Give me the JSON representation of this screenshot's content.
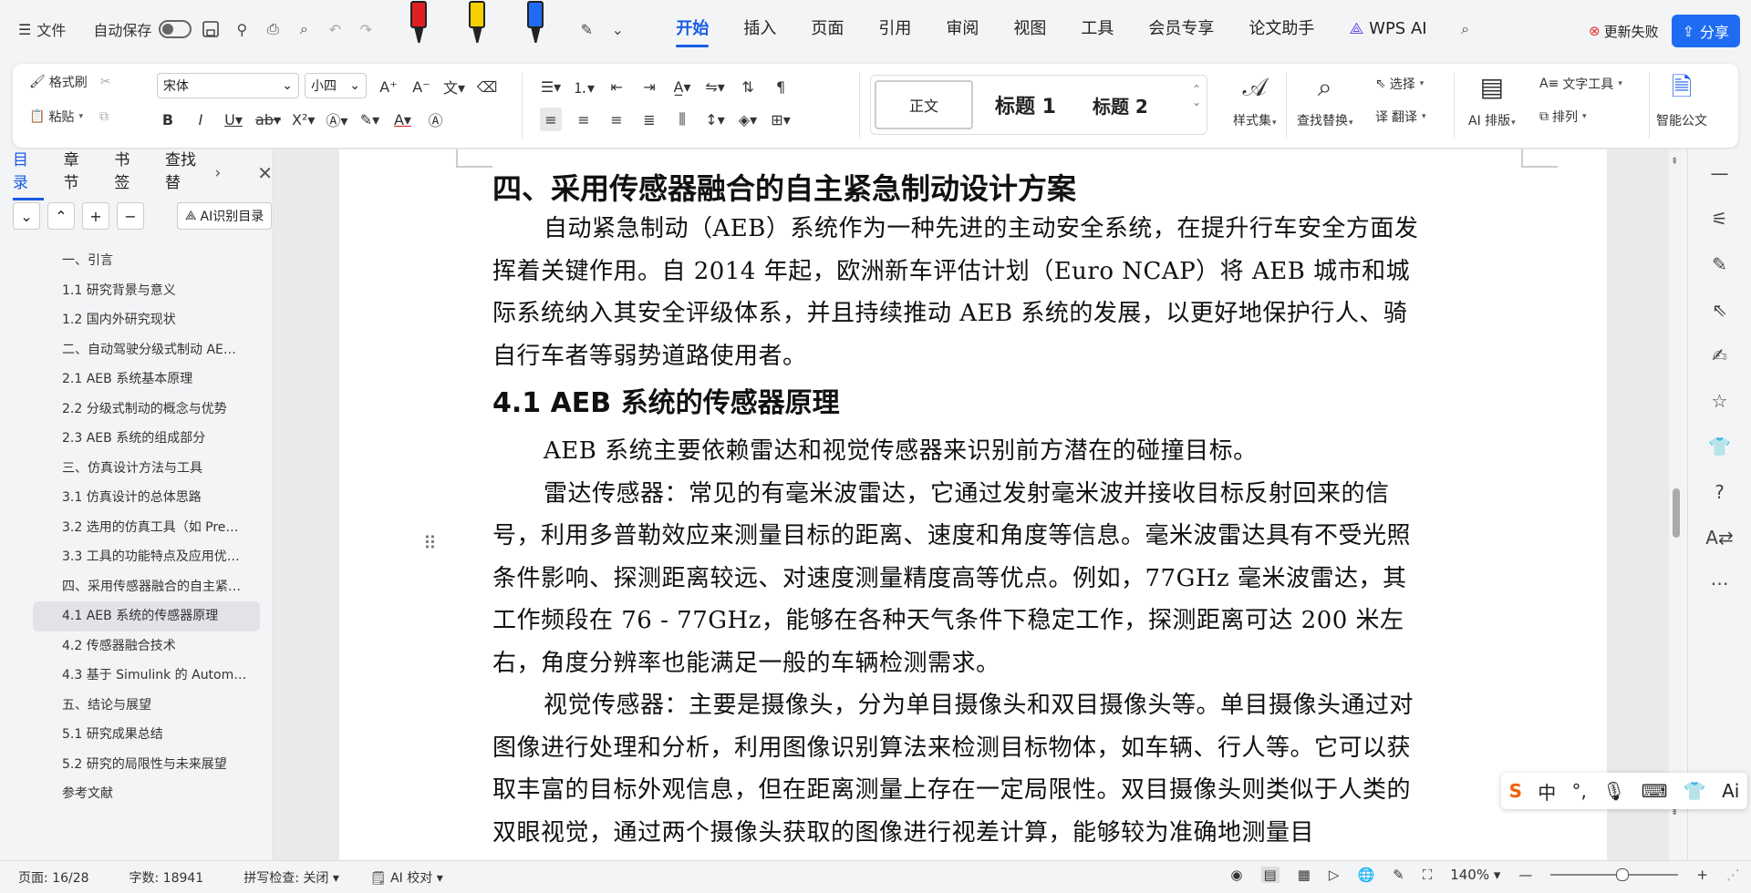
{
  "topbar": {
    "menu_label": "文件",
    "autosave_label": "自动保存",
    "tabs": [
      "开始",
      "插入",
      "页面",
      "引用",
      "审阅",
      "视图",
      "工具",
      "会员专享",
      "论文助手",
      "WPS AI"
    ],
    "active_tab": "开始",
    "update_label": "更新失败",
    "share_label": "分享"
  },
  "ribbon": {
    "format_painter": "格式刷",
    "paste": "粘贴",
    "font_name": "宋体",
    "font_size": "小四",
    "styles": {
      "normal": "正文",
      "h1": "标题 1",
      "h2": "标题 2"
    },
    "style_set": "样式集",
    "find_replace": "查找替换",
    "select": "选择",
    "translate": "翻译",
    "ai_layout": "AI 排版",
    "text_tools": "文字工具",
    "arrange": "排列",
    "smart_doc": "智能公文"
  },
  "leftpanel": {
    "tabs": [
      "目录",
      "章节",
      "书签",
      "查找替"
    ],
    "active_tab": "目录",
    "ai_toc_label": "AI识别目录",
    "toc": [
      "一、引言",
      "1.1 研究背景与意义",
      "1.2 国内外研究现状",
      "二、自动驾驶分级式制动 AE…",
      "2.1 AEB 系统基本原理",
      "2.2 分级式制动的概念与优势",
      "2.3 AEB 系统的组成部分",
      "三、仿真设计方法与工具",
      "3.1 仿真设计的总体思路",
      "3.2 选用的仿真工具（如 Pre…",
      "3.3 工具的功能特点及应用优…",
      "四、采用传感器融合的自主紧…",
      "4.1 AEB 系统的传感器原理",
      "4.2 传感器融合技术",
      "4.3 基于 Simulink 的 Autom…",
      "五、结论与展望",
      "5.1 研究成果总结",
      "5.2 研究的局限性与未来展望",
      "参考文献"
    ],
    "active_index": 12
  },
  "document": {
    "heading": "四、采用传感器融合的自主紧急制动设计方案",
    "para1": "自动紧急制动（AEB）系统作为一种先进的主动安全系统，在提升行车安全方面发挥着关键作用。自 2014 年起，欧洲新车评估计划（Euro NCAP）将 AEB 城市和城际系统纳入其安全评级体系，并且持续推动 AEB 系统的发展，以更好地保护行人、骑自行车者等弱势道路使用者。",
    "subheading": "4.1 AEB 系统的传感器原理",
    "para2": "AEB 系统主要依赖雷达和视觉传感器来识别前方潜在的碰撞目标。",
    "para3": "雷达传感器：常见的有毫米波雷达，它通过发射毫米波并接收目标反射回来的信号，利用多普勒效应来测量目标的距离、速度和角度等信息。毫米波雷达具有不受光照条件影响、探测距离较远、对速度测量精度高等优点。例如，77GHz 毫米波雷达，其工作频段在 76 - 77GHz，能够在各种天气条件下稳定工作，探测距离可达 200 米左右，角度分辨率也能满足一般的车辆检测需求。",
    "para4": "视觉传感器：主要是摄像头，分为单目摄像头和双目摄像头等。单目摄像头通过对图像进行处理和分析，利用图像识别算法来检测目标物体，如车辆、行人等。它可以获取丰富的目标外观信息，但在距离测量上存在一定局限性。双目摄像头则类似于人类的双眼视觉，通过两个摄像头获取的图像进行视差计算，能够较为准确地测量目"
  },
  "ime": {
    "lang": "中"
  },
  "status": {
    "page": "页面: 16/28",
    "words": "字数: 18941",
    "spellcheck": "拼写检查: 关闭",
    "ai_check": "AI 校对",
    "zoom": "140%"
  },
  "colors": {
    "accent": "#1a5ce6",
    "share_bg": "#1f6cf2",
    "marker_red": "#e02020",
    "marker_yellow": "#f5d000",
    "marker_blue": "#1f6cf2"
  }
}
